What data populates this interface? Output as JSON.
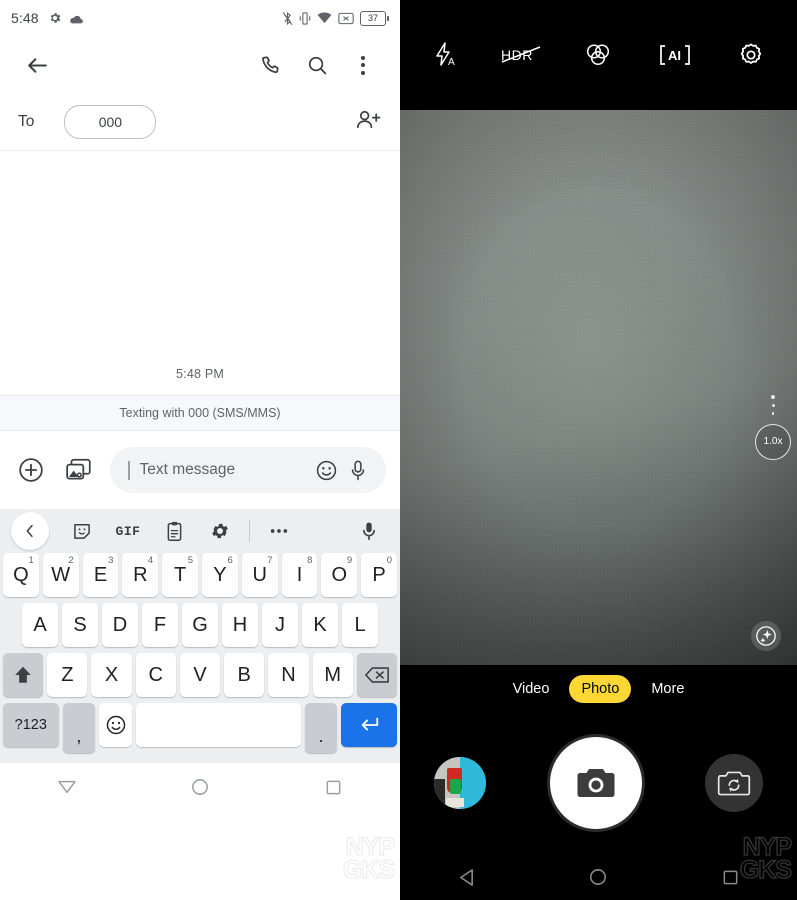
{
  "left_panel": {
    "app": "messages",
    "statusbar": {
      "time": "5:48",
      "battery_percent": "37",
      "left_icons": [
        "gear-icon",
        "cloud-icon"
      ],
      "right_icons": [
        "bluetooth-off-icon",
        "vibrate-icon",
        "wifi-icon",
        "no-sim-icon",
        "battery-icon"
      ]
    },
    "appbar": {
      "back": "back-arrow-icon",
      "call": "phone-icon",
      "search": "search-icon",
      "overflow": "more-vertical-icon"
    },
    "recipient_row": {
      "to_label": "To",
      "chip_value": "000",
      "add_contact": "add-person-icon"
    },
    "thread": {
      "timestamp": "5:48 PM",
      "banner": "Texting with 000 (SMS/MMS)"
    },
    "composer": {
      "attach": "plus-circle-icon",
      "media": "gallery-camera-icon",
      "placeholder": "Text message",
      "emoji": "emoji-icon",
      "mic": "microphone-icon"
    },
    "keyboard": {
      "toolbar": [
        "chevron-left-icon",
        "sticker-icon",
        "GIF",
        "clipboard-icon",
        "gear-icon",
        "more-horizontal-icon",
        "microphone-icon"
      ],
      "gif_label": "GIF",
      "row1": [
        {
          "letter": "Q",
          "num": "1"
        },
        {
          "letter": "W",
          "num": "2"
        },
        {
          "letter": "E",
          "num": "3"
        },
        {
          "letter": "R",
          "num": "4"
        },
        {
          "letter": "T",
          "num": "5"
        },
        {
          "letter": "Y",
          "num": "6"
        },
        {
          "letter": "U",
          "num": "7"
        },
        {
          "letter": "I",
          "num": "8"
        },
        {
          "letter": "O",
          "num": "9"
        },
        {
          "letter": "P",
          "num": "0"
        }
      ],
      "row2": [
        "A",
        "S",
        "D",
        "F",
        "G",
        "H",
        "J",
        "K",
        "L"
      ],
      "row3": [
        "Z",
        "X",
        "C",
        "V",
        "B",
        "N",
        "M"
      ],
      "shift": "shift-icon",
      "backspace": "backspace-icon",
      "symbols_key": "?123",
      "comma_key": ",",
      "emoji_key": "emoji-icon",
      "space_key": "",
      "period_key": ".",
      "enter_key": "enter-icon"
    },
    "navbar": {
      "back": "hide-keyboard-icon",
      "home": "home-circle-icon",
      "recents": "recents-square-icon"
    },
    "watermark": {
      "line1": "NYP",
      "line2": "GKS"
    }
  },
  "right_panel": {
    "app": "camera",
    "top_controls": [
      {
        "name": "flash-auto-icon",
        "label": "A"
      },
      {
        "name": "hdr-off-icon",
        "label": "HDR"
      },
      {
        "name": "color-filter-icon",
        "label": ""
      },
      {
        "name": "ai-scene-icon",
        "label": "AI"
      },
      {
        "name": "gear-icon",
        "label": ""
      }
    ],
    "viewfinder": {
      "zoom_level": "1.0x",
      "beauty_toggle": "sparkle-icon"
    },
    "modes": [
      {
        "label": "Video",
        "selected": false
      },
      {
        "label": "Photo",
        "selected": true
      },
      {
        "label": "More",
        "selected": false
      }
    ],
    "controls": {
      "gallery": "gallery-thumbnail",
      "shutter": "camera-shutter-icon",
      "flip": "flip-camera-icon"
    },
    "navbar": {
      "back": "back-triangle-icon",
      "home": "home-circle-icon",
      "recents": "recents-square-icon"
    },
    "watermark": {
      "line1": "NYP",
      "line2": "GKS"
    },
    "colors": {
      "accent": "#fdd835",
      "background": "#000000"
    }
  }
}
